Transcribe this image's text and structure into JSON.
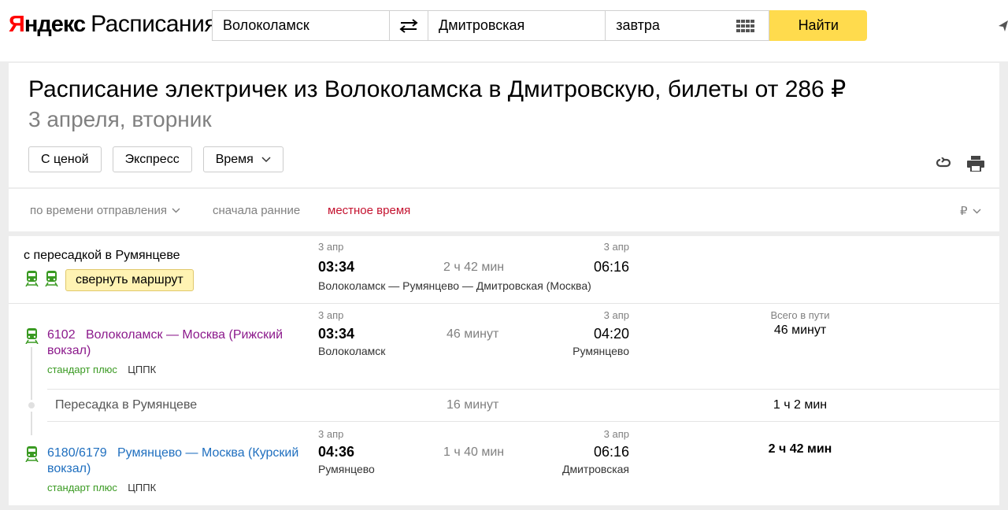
{
  "header": {
    "logo_brand_red": "Я",
    "logo_brand_rest": "ндекс",
    "logo_service": "Расписания",
    "from": "Волоколамск",
    "to": "Дмитровская",
    "date": "завтра",
    "find_label": "Найти"
  },
  "page": {
    "title": "Расписание электричек из Волоколамска в Дмитровскую, билеты от 286 ₽",
    "subtitle": "3 апреля, вторник",
    "filters": {
      "price": "С ценой",
      "express": "Экспресс",
      "time": "Время"
    }
  },
  "sort": {
    "by": "по времени отправления",
    "order": "сначала ранние",
    "timezone": "местное время",
    "currency": "₽"
  },
  "summary": {
    "transfer_label": "с пересадкой в Румянцеве",
    "collapse_label": "свернуть маршрут",
    "dep_date": "3 апр",
    "dep_time": "03:34",
    "duration": "2 ч 42 мин",
    "arr_date": "3 апр",
    "arr_time": "06:16",
    "route": "Волоколамск — Румянцево — Дмитровская (Москва)"
  },
  "segments": [
    {
      "number": "6102",
      "name": "Волоколамск — Москва (Рижский вокзал)",
      "class": "стандарт плюс",
      "carrier": "ЦППК",
      "dep_date": "3 апр",
      "dep_time": "03:34",
      "dep_station": "Волоколамск",
      "duration": "46 минут",
      "arr_date": "3 апр",
      "arr_time": "04:20",
      "arr_station": "Румянцево",
      "total_label": "Всего в пути",
      "total": "46 минут"
    },
    {
      "number": "6180/6179",
      "name": "Румянцево — Москва (Курский вокзал)",
      "class": "стандарт плюс",
      "carrier": "ЦППК",
      "dep_date": "3 апр",
      "dep_time": "04:36",
      "dep_station": "Румянцево",
      "duration": "1 ч 40 мин",
      "arr_date": "3 апр",
      "arr_time": "06:16",
      "arr_station": "Дмитровская",
      "total": "2 ч 42 мин"
    }
  ],
  "transfer": {
    "label": "Пересадка в Румянцеве",
    "wait": "16 минут",
    "total": "1 ч 2 мин"
  },
  "colors": {
    "accent_yellow": "#ffdb4d",
    "brand_red": "#ff0000",
    "timezone_red": "#c4122f",
    "train_green": "#3a9a22",
    "route_purple": "#8c1a8c",
    "route_blue": "#1f6fbf"
  }
}
